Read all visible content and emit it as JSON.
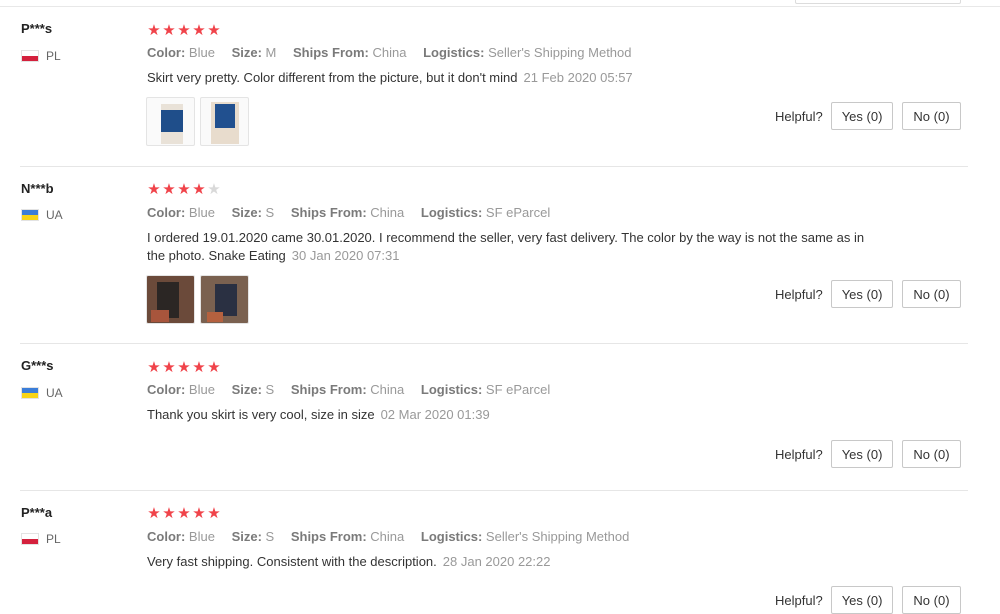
{
  "labels": {
    "color": "Color:",
    "size": "Size:",
    "ships_from": "Ships From:",
    "logistics": "Logistics:",
    "helpful": "Helpful?"
  },
  "colors": {
    "star": "#f0434a",
    "star_off": "#d9d9d9"
  },
  "reviews": [
    {
      "user": "P***s",
      "country": "PL",
      "flag": "poland-flag",
      "rating": 5,
      "color": "Blue",
      "size": "M",
      "ships_from": "China",
      "logistics": "Seller's Shipping Method",
      "text": "Skirt very pretty. Color different from the picture, but it don't mind",
      "date": "21 Feb 2020 05:57",
      "yes": "Yes (0)",
      "no": "No (0)",
      "photos": 2
    },
    {
      "user": "N***b",
      "country": "UA",
      "flag": "ukraine-flag",
      "rating": 4,
      "color": "Blue",
      "size": "S",
      "ships_from": "China",
      "logistics": "SF eParcel",
      "text": "I ordered 19.01.2020 came 30.01.2020. I recommend the seller, very fast delivery. The color by the way is not the same as in the photo. Snake Eating",
      "date": "30 Jan 2020 07:31",
      "yes": "Yes (0)",
      "no": "No (0)",
      "photos": 2
    },
    {
      "user": "G***s",
      "country": "UA",
      "flag": "ukraine-flag",
      "rating": 5,
      "color": "Blue",
      "size": "S",
      "ships_from": "China",
      "logistics": "SF eParcel",
      "text": "Thank you skirt is very cool, size in size",
      "date": "02 Mar 2020 01:39",
      "yes": "Yes (0)",
      "no": "No (0)",
      "photos": 0
    },
    {
      "user": "P***a",
      "country": "PL",
      "flag": "poland-flag",
      "rating": 5,
      "color": "Blue",
      "size": "S",
      "ships_from": "China",
      "logistics": "Seller's Shipping Method",
      "text": "Very fast shipping. Consistent with the description.",
      "date": "28 Jan 2020 22:22",
      "yes": "Yes (0)",
      "no": "No (0)",
      "photos": 0
    }
  ]
}
